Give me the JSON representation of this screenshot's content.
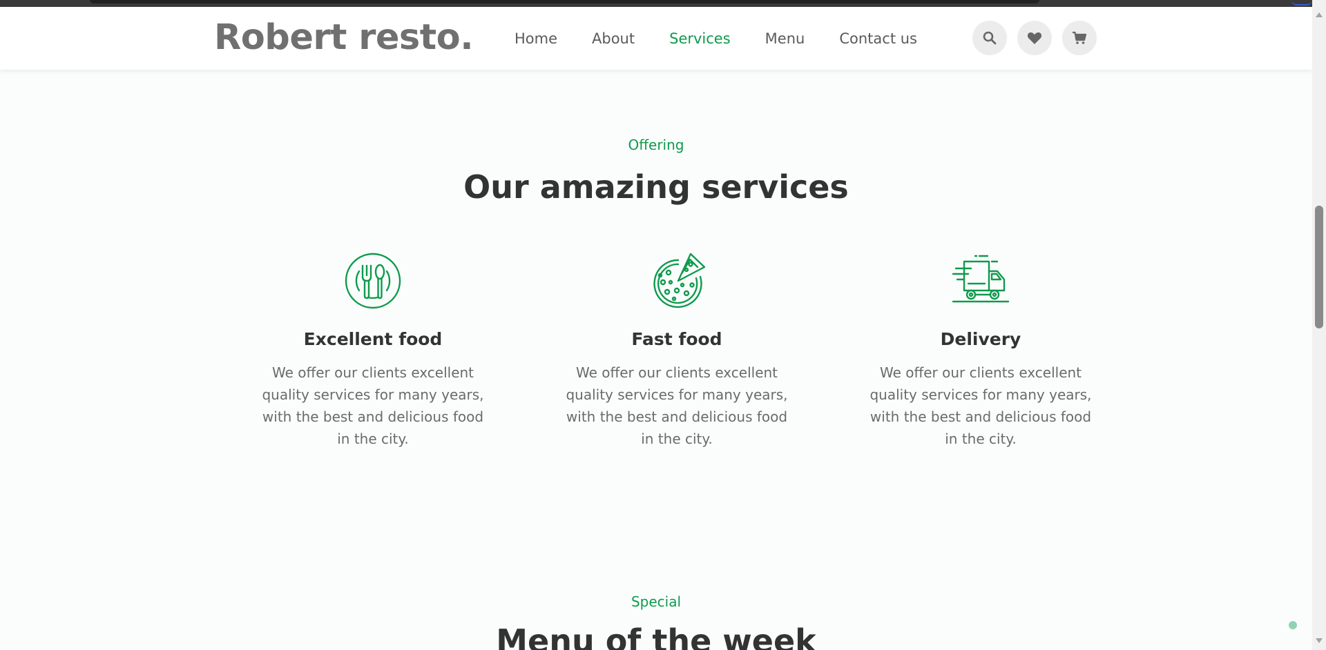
{
  "header": {
    "logo": "Robert resto.",
    "nav": [
      {
        "label": "Home",
        "active": false
      },
      {
        "label": "About",
        "active": false
      },
      {
        "label": "Services",
        "active": true
      },
      {
        "label": "Menu",
        "active": false
      },
      {
        "label": "Contact us",
        "active": false
      }
    ],
    "icons": [
      "search-icon",
      "heart-icon",
      "cart-icon"
    ]
  },
  "services_section": {
    "eyebrow": "Offering",
    "title": "Our amazing services",
    "items": [
      {
        "icon": "plate-cutlery-icon",
        "title": "Excellent food",
        "text": "We offer our clients excellent quality services for many years, with the best and delicious food in the city."
      },
      {
        "icon": "pizza-icon",
        "title": "Fast food",
        "text": "We offer our clients excellent quality services for many years, with the best and delicious food in the city."
      },
      {
        "icon": "delivery-truck-icon",
        "title": "Delivery",
        "text": "We offer our clients excellent quality services for many years, with the best and delicious food in the city."
      }
    ]
  },
  "special_section": {
    "eyebrow": "Special",
    "title": "Menu of the week"
  },
  "colors": {
    "accent": "#0e9a4c",
    "text_dark": "#333333",
    "text_muted": "#6a6a6a",
    "logo": "#707070",
    "background": "#fbfdfd"
  }
}
